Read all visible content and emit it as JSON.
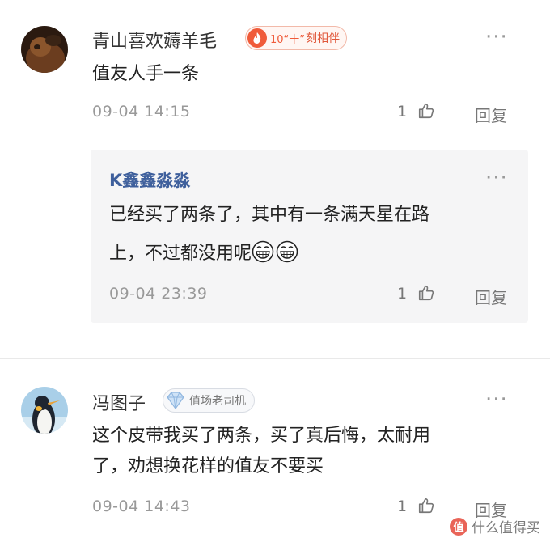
{
  "comments": [
    {
      "username": "青山喜欢薅羊毛",
      "badge_text": "刻相伴",
      "badge_prefix": "10“十”",
      "text": "值友人手一条",
      "timestamp": "09-04 14:15",
      "likes": "1",
      "reply_label": "回复",
      "more": "···",
      "replies": [
        {
          "username": "K鑫鑫淼淼",
          "text_line1": "已经买了两条了，其中有一条满天星在路",
          "text_line2": "上，不过都没用呢",
          "timestamp": "09-04 23:39",
          "likes": "1",
          "reply_label": "回复",
          "more": "···"
        }
      ]
    },
    {
      "username": "冯图子",
      "badge_text": "值场老司机",
      "text_line1": "这个皮带我买了两条，买了真后悔，太耐用",
      "text_line2": "了，劝想换花样的值友不要买",
      "timestamp": "09-04 14:43",
      "likes": "1",
      "reply_label": "回复",
      "more": "···"
    }
  ],
  "watermark": "什么值得买",
  "colors": {
    "reply_username": "#3e5f9c",
    "badge_red": "#f05b3a",
    "meta_gray": "#999999"
  },
  "icons": [
    "thumbs-up-icon",
    "more-dots-icon",
    "fire-badge-icon",
    "diamond-badge-icon",
    "grin-emoji-icon"
  ]
}
